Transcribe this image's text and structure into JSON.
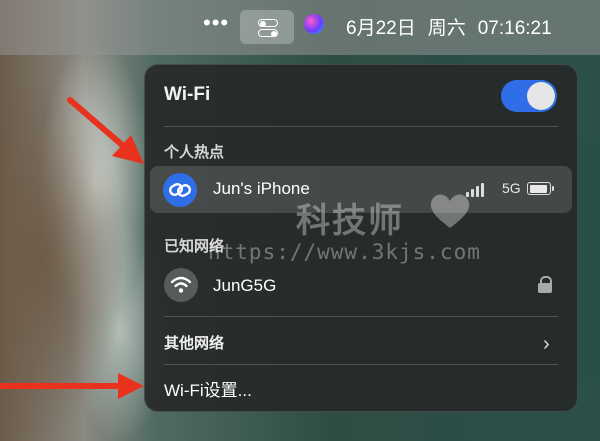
{
  "menubar": {
    "more_glyph": "•••",
    "date": "6月22日",
    "weekday": "周六",
    "time": "07:16:21"
  },
  "wifi_panel": {
    "title": "Wi-Fi",
    "wifi_enabled": true,
    "toggle_color": "#2f6ee6",
    "personal_hotspot_label": "个人热点",
    "hotspot": {
      "name": "Jun's iPhone",
      "icon": "link-chain-icon",
      "band": "5G",
      "signal_bars": 4
    },
    "known_networks_label": "已知网络",
    "known_network": {
      "name": "JunG5G",
      "icon": "wifi-icon",
      "secured": true
    },
    "other_networks_label": "其他网络",
    "settings_label": "Wi-Fi设置..."
  },
  "watermark": {
    "title": "科技师",
    "url": "https://www.3kjs.com"
  }
}
